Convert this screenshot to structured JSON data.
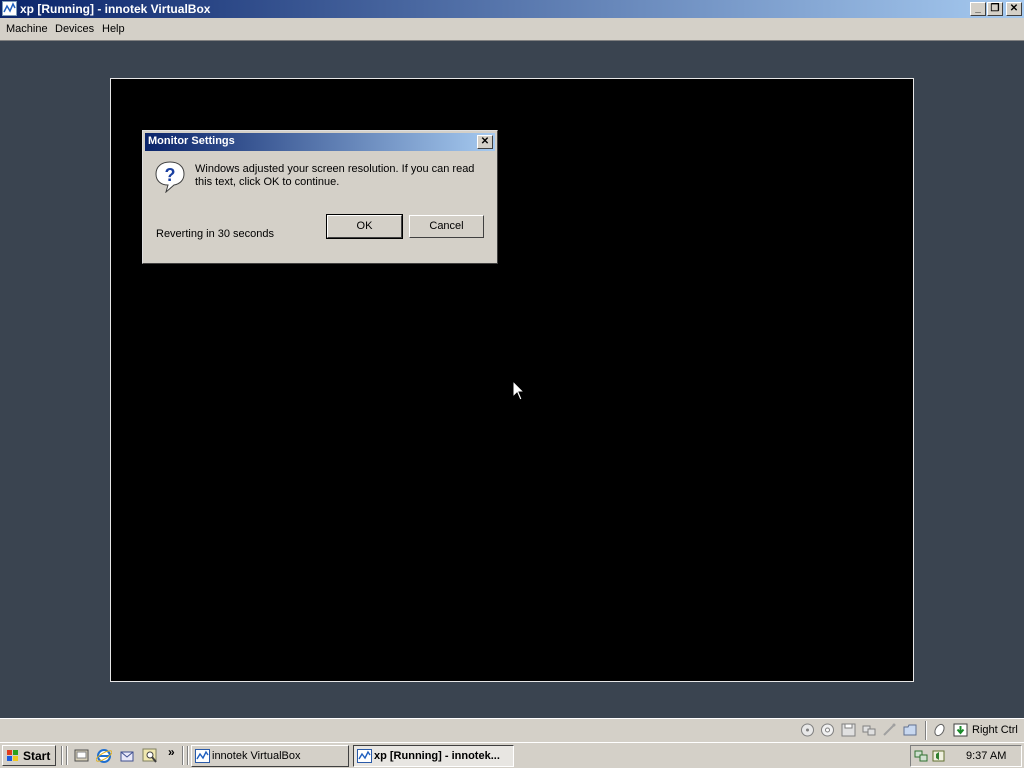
{
  "host_window": {
    "title": "xp [Running] - innotek VirtualBox",
    "menu": [
      "Machine",
      "Devices",
      "Help"
    ]
  },
  "dialog": {
    "title": "Monitor Settings",
    "message": "Windows adjusted your screen resolution. If you can read this text, click OK to continue.",
    "status": "Reverting in 30 seconds",
    "ok_label": "OK",
    "cancel_label": "Cancel"
  },
  "statusbar": {
    "host_key": "Right Ctrl"
  },
  "taskbar": {
    "start_label": "Start",
    "chevron": "»",
    "tasks": [
      "innotek VirtualBox",
      "xp [Running] - innotek..."
    ],
    "clock": "9:37 AM"
  },
  "colors": {
    "titlebar_start": "#0a246a",
    "titlebar_end": "#a6caf0",
    "chrome": "#d4d0c8",
    "desktop": "#3a4450"
  }
}
